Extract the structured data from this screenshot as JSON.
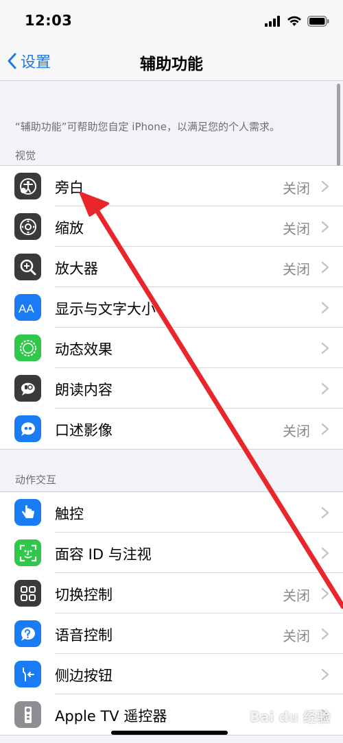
{
  "status": {
    "time": "12:03"
  },
  "nav": {
    "back_label": "设置",
    "title": "辅助功能"
  },
  "description": "“辅助功能”可帮助您自定 iPhone，以满足您的个人需求。",
  "sections": [
    {
      "header": "视觉",
      "items": [
        {
          "label": "旁白",
          "value": "关闭",
          "icon": "voiceover-icon",
          "color": "#3a3a3c"
        },
        {
          "label": "缩放",
          "value": "关闭",
          "icon": "zoom-icon",
          "color": "#3a3a3c"
        },
        {
          "label": "放大器",
          "value": "关闭",
          "icon": "magnifier-icon",
          "color": "#3a3a3c"
        },
        {
          "label": "显示与文字大小",
          "value": "",
          "icon": "text-size-icon",
          "color": "#1a7cf5"
        },
        {
          "label": "动态效果",
          "value": "",
          "icon": "motion-icon",
          "color": "#2fc84a"
        },
        {
          "label": "朗读内容",
          "value": "",
          "icon": "spoken-content-icon",
          "color": "#3a3a3c"
        },
        {
          "label": "口述影像",
          "value": "关闭",
          "icon": "audio-description-icon",
          "color": "#1a7cf5"
        }
      ]
    },
    {
      "header": "动作交互",
      "items": [
        {
          "label": "触控",
          "value": "",
          "icon": "touch-icon",
          "color": "#1a7cf5"
        },
        {
          "label": "面容 ID 与注视",
          "value": "",
          "icon": "face-id-icon",
          "color": "#2fc84a"
        },
        {
          "label": "切换控制",
          "value": "关闭",
          "icon": "switch-control-icon",
          "color": "#3a3a3c"
        },
        {
          "label": "语音控制",
          "value": "关闭",
          "icon": "voice-control-icon",
          "color": "#1a7cf5"
        },
        {
          "label": "侧边按钮",
          "value": "",
          "icon": "side-button-icon",
          "color": "#1a7cf5"
        },
        {
          "label": "Apple TV 遥控器",
          "value": "",
          "icon": "apple-tv-remote-icon",
          "color": "#8e8e93"
        }
      ]
    }
  ],
  "watermark": "Bai du 经验",
  "colors": {
    "accent": "#1f7ae0",
    "annotation_arrow": "#e8262b"
  }
}
